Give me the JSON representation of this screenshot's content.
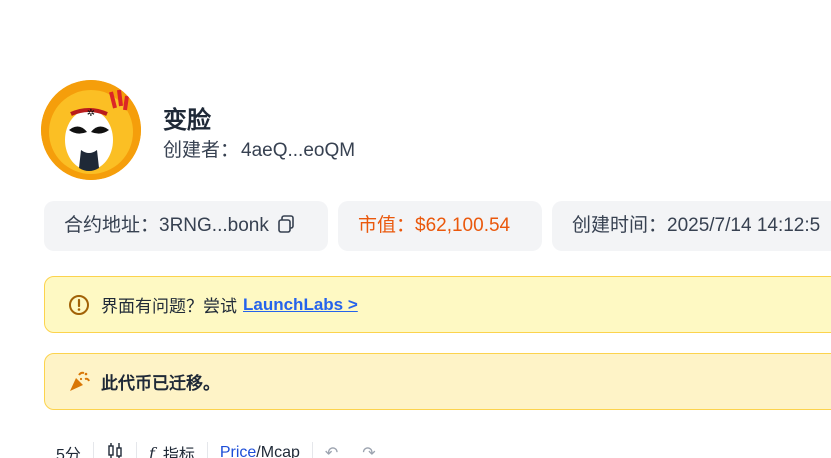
{
  "token": {
    "name": "变脸",
    "creator_label": "创建者：",
    "creator_address": "4aeQ...eoQM"
  },
  "info": {
    "contract_label": "合约地址：",
    "contract_value": "3RNG...bonk",
    "mcap_label": "市值：",
    "mcap_value": "$62,100.54",
    "created_label": "创建时间：",
    "created_value": "2025/7/14 14:12:5"
  },
  "notices": {
    "issue_text": "界面有问题？尝试",
    "issue_link": "LaunchLabs >",
    "migrated_text": "此代币已迁移。"
  },
  "toolbar": {
    "interval": "5分",
    "indicators_label": "指标",
    "price_label": "Price",
    "slash": "/",
    "mcap_label": "Mcap"
  },
  "colors": {
    "accent_orange": "#ea580c",
    "link_blue": "#2563eb",
    "notice_yellow": "#fef9c3"
  },
  "icons": [
    "avatar-opera-mask",
    "copy-icon",
    "info-circle-icon",
    "party-popper-icon",
    "candlestick-icon",
    "function-icon",
    "undo-icon",
    "redo-icon"
  ]
}
